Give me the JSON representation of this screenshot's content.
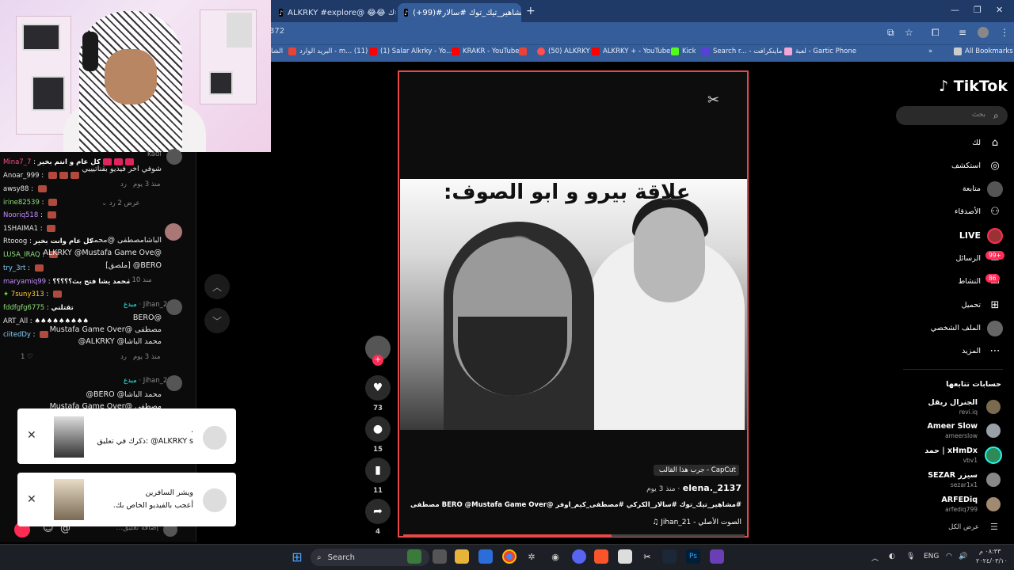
{
  "browser": {
    "tabs": [
      {
        "label": "ALKRKY #explore@ 😂😂 ة#ك",
        "active": false
      },
      {
        "label": "(+99)#مشاهير_تيك_توك #سالار...",
        "active": true
      }
    ],
    "new_tab": "+",
    "window_controls": {
      "minimize": "—",
      "maximize": "❐",
      "close": "✕"
    },
    "url": "372",
    "bookmarks": [
      {
        "label": "البريد الوارد - m... (11)",
        "color": "#ea4335"
      },
      {
        "label": "(1) Salar Alkrky - Yo...",
        "color": "#ff0000"
      },
      {
        "label": "KRAKR - YouTube",
        "color": "#ff0000"
      },
      {
        "label": "(50) ALKRKY",
        "color": "#ff4f4f"
      },
      {
        "label": "ALKRKY + - YouTube",
        "color": "#ff0000"
      },
      {
        "label": "Kick",
        "color": "#53fc18"
      },
      {
        "label": "Search r... - ماينكرافت",
        "color": "#5a3fd8"
      },
      {
        "label": "لعبة - Gartic Phone",
        "color": "#f4a7d4"
      }
    ],
    "bookmarks_more": "»",
    "all_bookmarks": "All Bookmarks",
    "bookmark_left_fragment": "الشا"
  },
  "chat": {
    "lines": [
      {
        "user": "Mina7_7",
        "user_color": "#ff4a8a",
        "text": "كل عام و انتم بخير"
      },
      {
        "user": "Anoar_999",
        "user_color": "#e6e6e6",
        "text": ""
      },
      {
        "user": "awsy88",
        "user_color": "#e6e6e6",
        "text": ""
      },
      {
        "user": "irine82539",
        "user_color": "#8ee07a",
        "text": ""
      },
      {
        "user": "Nooriq518",
        "user_color": "#c48cff",
        "text": ""
      },
      {
        "user": "1SHAIMA1",
        "user_color": "#e6e6e6",
        "text": ""
      },
      {
        "user": "Rtooog",
        "user_color": "#e6e6e6",
        "text": "كل عام وانت بخير"
      },
      {
        "user": "LUSA_IRAQ",
        "user_color": "#8ee07a",
        "text": ""
      },
      {
        "user": "try_3rt",
        "user_color": "#7fd0ff",
        "text": ""
      },
      {
        "user": "maryamiq99",
        "user_color": "#c48cff",
        "text": "محمد يشا فتح بث؟؟؟؟؟"
      },
      {
        "user": "7suny313",
        "user_color": "#ffcc33",
        "text": ""
      },
      {
        "user": "fddfgfg6775",
        "user_color": "#8ee07a",
        "text": "تقتلني"
      },
      {
        "user": "ART_All",
        "user_color": "#e6e6e6",
        "text": "♠♠♠♠♠♠♠♠♠"
      },
      {
        "user": "ciitedDy",
        "user_color": "#7fd0ff",
        "text": ""
      }
    ]
  },
  "comments": {
    "c1_user": "kadi",
    "c1_text": "شوفي اخر فيديو بقناتيييي",
    "c1_meta": "منذ 3 يوم",
    "reply": "رد",
    "c1_views": "عرض 2 رد",
    "c2_text1": "الباشامصطفى @محمد",
    "c2_text2": "@ALKRKY @Mustafa Game Ove",
    "c2_text3": "BERO@ [ملصق]",
    "c2_meta": "منذ 10 د",
    "c3_user": "Jihan_21",
    "c3_badge": "مبدع",
    "c3_text1": "@BERO",
    "c3_text2": "مصطفى @Mustafa Game Over",
    "c3_text3": "محمد الباشا@ ALKRKY@",
    "c3_meta": "منذ 3 يوم",
    "c3_likes": "1",
    "c4_user": "Jihan_21",
    "c4_badge": "مبدع",
    "c4_text1": "محمد الباشا@ BERO@",
    "c4_text2": "مصطفى @Mustafa Game Over",
    "input_placeholder": "إضافة تعليق..."
  },
  "notifications": [
    {
      "text": "ALKRKY s@ :ذكرك في تعليق",
      "dot": "."
    },
    {
      "title": "ويشر السافرين",
      "text": "أعجب بالفيديو الخاص بك."
    }
  ],
  "video": {
    "overlay_caption": "علاقة بيرو و ابو الصوف:",
    "capcut_tag": "CapCut - جرب هذا القالب",
    "author": "elena._2137",
    "posted": "· منذ 3 يوم",
    "description": "#مشاهير_تيك_توك #سالار_الكركي #مصطفى_كيم_اوفر @BERO @Mustafa Game Over مصطفى",
    "sound": "الصوت الأصلي - Jihan_21",
    "progress": 0.61
  },
  "actions": {
    "likes": "73",
    "comments": "15",
    "saves": "11",
    "shares": "4"
  },
  "tiktok_nav": {
    "logo": "TikTok",
    "search_placeholder": "بحث",
    "items": [
      {
        "label": "لك",
        "icon": "home-icon",
        "glyph": "⌂",
        "badge": ""
      },
      {
        "label": "استكشف",
        "icon": "compass-icon",
        "glyph": "◎",
        "badge": ""
      },
      {
        "label": "متابعة",
        "icon": "following-icon",
        "glyph": "●",
        "badge": ""
      },
      {
        "label": "الأصدقاء",
        "icon": "friends-icon",
        "glyph": "👥",
        "badge": ""
      },
      {
        "label": "LIVE",
        "icon": "live-icon",
        "glyph": "●",
        "badge": ""
      },
      {
        "label": "الرسائل",
        "icon": "messages-icon",
        "glyph": "✉",
        "badge": "99+"
      },
      {
        "label": "النشاط",
        "icon": "activity-icon",
        "glyph": "💬",
        "badge": "86"
      },
      {
        "label": "تحميل",
        "icon": "upload-icon",
        "glyph": "⊕",
        "badge": ""
      },
      {
        "label": "الملف الشخصي",
        "icon": "profile-icon",
        "glyph": "●",
        "badge": ""
      },
      {
        "label": "المزيد",
        "icon": "more-icon",
        "glyph": "⋯",
        "badge": ""
      }
    ],
    "following_title": "حسابات تتابعها",
    "following": [
      {
        "name": "الجنرال ريقل",
        "handle": "revi.iq"
      },
      {
        "name": "Ameer Slow",
        "handle": "ameerslow"
      },
      {
        "name": "حمد | xHmDx",
        "handle": "vbv1"
      },
      {
        "name": "SEZAR سيزر",
        "handle": "sezar1x1"
      },
      {
        "name": "ARFEDiq",
        "handle": "arfediq799"
      }
    ],
    "see_all": "عرض الكل"
  },
  "taskbar": {
    "search": "Search",
    "lang": "ENG",
    "time": "٠٨:٣٣ م",
    "date": "٢٠٢٤/٠٣/١٠"
  }
}
